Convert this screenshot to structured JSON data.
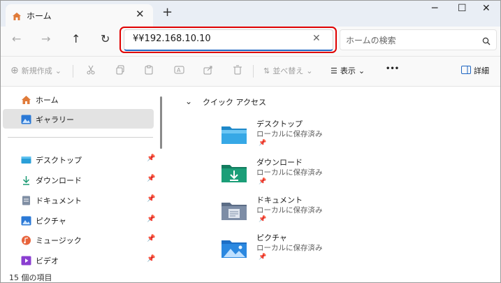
{
  "tab": {
    "title": "ホーム",
    "close": "✕",
    "new_tab": "+"
  },
  "window": {
    "minimize": "─",
    "maximize": "☐",
    "close": "✕"
  },
  "address": {
    "value": "¥¥192.168.10.10",
    "clear": "✕"
  },
  "search": {
    "placeholder": "ホームの検索"
  },
  "nav": {
    "back": "←",
    "forward": "→",
    "up": "↑",
    "refresh": "↻"
  },
  "commands": {
    "new": "新規作成",
    "sort": "並べ替え",
    "view": "表示",
    "more": "•••",
    "details": "詳細"
  },
  "sidebar": {
    "items": [
      {
        "label": "ホーム",
        "icon": "home-icon"
      },
      {
        "label": "ギャラリー",
        "icon": "gallery-icon",
        "selected": true
      }
    ],
    "pinned": [
      {
        "label": "デスクトップ",
        "icon": "desktop-icon"
      },
      {
        "label": "ダウンロード",
        "icon": "download-icon"
      },
      {
        "label": "ドキュメント",
        "icon": "document-icon"
      },
      {
        "label": "ピクチャ",
        "icon": "pictures-icon"
      },
      {
        "label": "ミュージック",
        "icon": "music-icon"
      },
      {
        "label": "ビデオ",
        "icon": "video-icon"
      }
    ]
  },
  "main": {
    "section_title": "クイック アクセス",
    "items": [
      {
        "name": "デスクトップ",
        "sub": "ローカルに保存済み",
        "icon": "desktop-folder-icon"
      },
      {
        "name": "ダウンロード",
        "sub": "ローカルに保存済み",
        "icon": "downloads-folder-icon"
      },
      {
        "name": "ドキュメント",
        "sub": "ローカルに保存済み",
        "icon": "documents-folder-icon"
      },
      {
        "name": "ピクチャ",
        "sub": "ローカルに保存済み",
        "icon": "pictures-folder-icon"
      }
    ]
  },
  "status": {
    "count": "15 個の項目"
  },
  "colors": {
    "accent": "#1f66c2",
    "highlight": "#e00000",
    "selected_bg": "#e3e3e3"
  }
}
